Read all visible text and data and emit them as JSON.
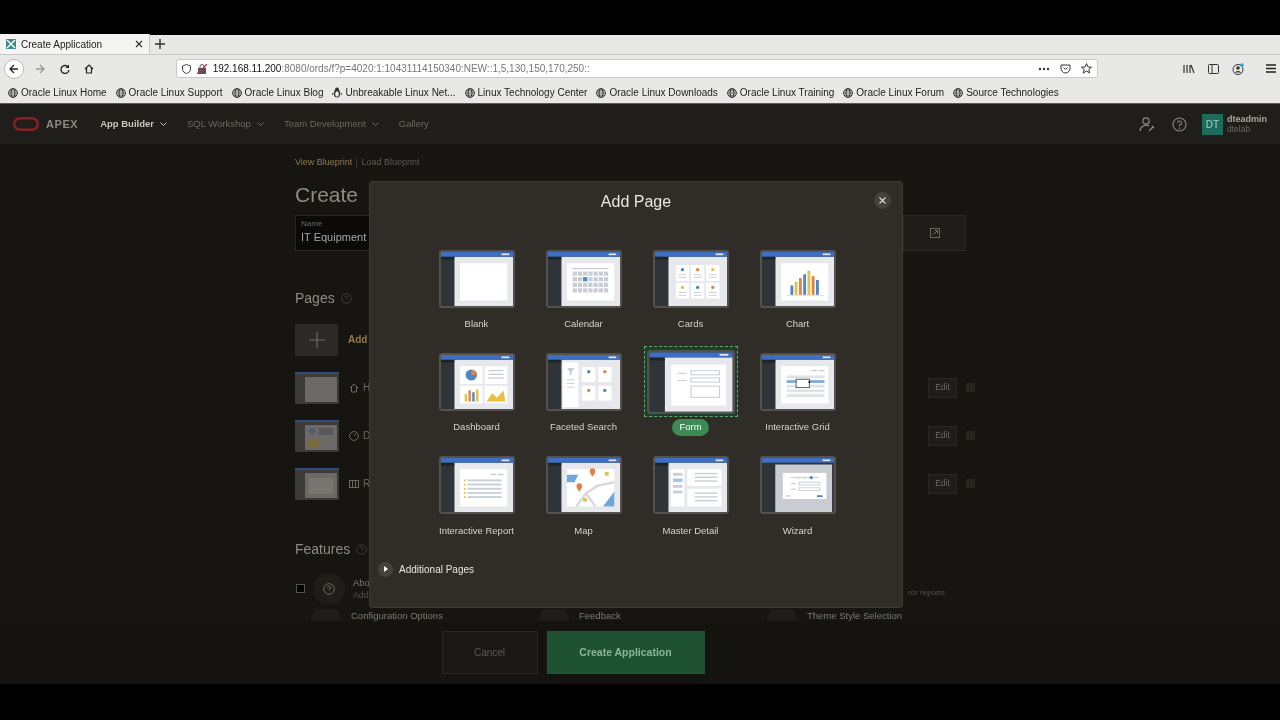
{
  "browser": {
    "tab": {
      "title": "Create Application"
    },
    "url": {
      "host": "192.168.11.200",
      "rest": ":8080/ords/f?p=4020:1:10431114150340:NEW::1,5,130,150,170,250::"
    },
    "bookmarks": [
      {
        "label": "Oracle Linux Home",
        "kind": "globe"
      },
      {
        "label": "Oracle Linux Support",
        "kind": "globe"
      },
      {
        "label": "Oracle Linux Blog",
        "kind": "globe"
      },
      {
        "label": "Unbreakable Linux Net...",
        "kind": "penguin"
      },
      {
        "label": "Linux Technology Center",
        "kind": "globe"
      },
      {
        "label": "Oracle Linux Downloads",
        "kind": "globe"
      },
      {
        "label": "Oracle Linux Training",
        "kind": "globe"
      },
      {
        "label": "Oracle Linux Forum",
        "kind": "globe"
      },
      {
        "label": "Source Technologies",
        "kind": "globe"
      }
    ]
  },
  "header": {
    "brand": "APEX",
    "nav": [
      {
        "label": "App Builder",
        "selected": true,
        "dropdown": true
      },
      {
        "label": "SQL Workshop",
        "selected": false,
        "dropdown": true
      },
      {
        "label": "Team Development",
        "selected": false,
        "dropdown": true
      },
      {
        "label": "Gallery",
        "selected": false,
        "dropdown": false
      }
    ],
    "user": {
      "initials": "DT",
      "name": "dteadmin",
      "workspace": "dtelab"
    }
  },
  "background": {
    "links": [
      {
        "label": "View Blueprint",
        "selected": true
      },
      {
        "label": "Load Blueprint",
        "selected": false
      }
    ],
    "title": "Create",
    "name_field": {
      "label": "Name",
      "value": "IT Equipment"
    },
    "pages_heading": "Pages",
    "add_page": "Add",
    "page_rows": [
      {
        "label": "H",
        "kind": "home",
        "edit": "Edit"
      },
      {
        "label": "D",
        "kind": "dashboard",
        "edit": "Edit"
      },
      {
        "label": "R",
        "kind": "report",
        "edit": "Edit"
      }
    ],
    "features_heading": "Features",
    "feature_1": {
      "checked": false,
      "title": "Abo",
      "subtitle": "Add",
      "right_text": "ror reports"
    },
    "feature_2": [
      {
        "label": "Configuration Options"
      },
      {
        "label": "Feedback"
      },
      {
        "label": "Theme Style Selection"
      }
    ]
  },
  "modal": {
    "title": "Add Page",
    "page_types": [
      {
        "label": "Blank",
        "kind": "blank",
        "selected": false
      },
      {
        "label": "Calendar",
        "kind": "calendar",
        "selected": false
      },
      {
        "label": "Cards",
        "kind": "cards",
        "selected": false
      },
      {
        "label": "Chart",
        "kind": "chart",
        "selected": false
      },
      {
        "label": "Dashboard",
        "kind": "dashboard",
        "selected": false
      },
      {
        "label": "Faceted Search",
        "kind": "faceted",
        "selected": false
      },
      {
        "label": "Form",
        "kind": "form",
        "selected": true
      },
      {
        "label": "Interactive Grid",
        "kind": "grid",
        "selected": false
      },
      {
        "label": "Interactive Report",
        "kind": "report",
        "selected": false
      },
      {
        "label": "Map",
        "kind": "map",
        "selected": false
      },
      {
        "label": "Master Detail",
        "kind": "master",
        "selected": false
      },
      {
        "label": "Wizard",
        "kind": "wizard",
        "selected": false
      }
    ],
    "additional": {
      "label": "Additional Pages"
    }
  },
  "footer": {
    "cancel": "Cancel",
    "create": "Create Application"
  }
}
